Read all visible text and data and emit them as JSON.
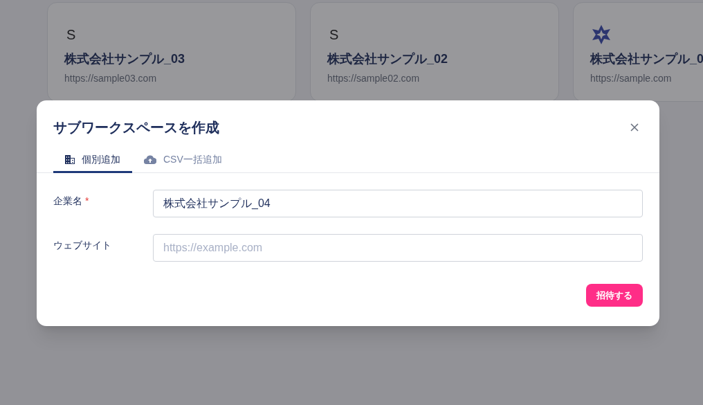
{
  "cards": [
    {
      "logo": {
        "kind": "letter",
        "text": "S"
      },
      "name": "株式会社サンプル_03",
      "url": "https://sample03.com"
    },
    {
      "logo": {
        "kind": "letter",
        "text": "S"
      },
      "name": "株式会社サンプル_02",
      "url": "https://sample02.com"
    },
    {
      "logo": {
        "kind": "image"
      },
      "name": "株式会社サンプル_0",
      "url": "https://sample.com"
    }
  ],
  "dialog": {
    "title": "サブワークスペースを作成",
    "tabs": [
      {
        "label": "個別追加",
        "kind": "building",
        "selected": true
      },
      {
        "label": "CSV一括追加",
        "kind": "upload",
        "selected": false
      }
    ],
    "fields": [
      {
        "label": "企業名",
        "required_mark": "*",
        "value": "株式会社サンプル_04"
      },
      {
        "label": "ウェブサイト",
        "placeholder": "https://example.com"
      }
    ],
    "submit": "招待する"
  }
}
